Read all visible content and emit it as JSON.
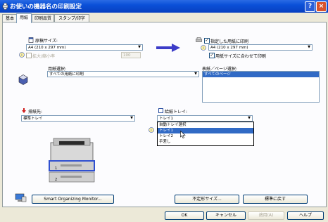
{
  "window": {
    "title": "お使いの機器名の印刷設定",
    "help_label": "?",
    "close_label": "×"
  },
  "tabs": [
    {
      "label": "基本",
      "active": false
    },
    {
      "label": "用紙",
      "active": true
    },
    {
      "label": "印刷品質",
      "active": false
    },
    {
      "label": "スタンプ/印字",
      "active": false
    }
  ],
  "paper": {
    "original_size_label": "原稿サイズ:",
    "original_size_value": "A4 (210 x 297 mm)",
    "zoom_label": "拡大/縮小率",
    "zoom_value": "100",
    "print_on_label": "指定した用紙に印刷",
    "print_on_value": "A4 (210 x 297 mm)",
    "fit_label": "用紙サイズに合わせて印刷",
    "type_label": "用紙選択:",
    "type_value": "すべての用紙に印刷",
    "cover_label": "表紙／ページ選択:",
    "cover_items": [
      "すべてのページ"
    ]
  },
  "output": {
    "destination_label": "排紙先:",
    "destination_value": "標準トレイ",
    "source_label": "給紙トレイ:",
    "source_value": "トレイ1",
    "source_options": [
      "自動トレイ選択",
      "トレイ1",
      "トレイ2",
      "手差し"
    ],
    "source_highlighted_index": 1,
    "tray_labels": [
      "1",
      "2"
    ]
  },
  "bottom": {
    "smart_monitor_label": "Smart Organizing Monitor...",
    "custom_size_label": "不定形サイズ...",
    "restore_label": "標準に戻す"
  },
  "dialog": {
    "ok_label": "OK",
    "cancel_label": "キャンセル",
    "apply_label": "適用(A)",
    "help_label": "ヘルプ"
  }
}
